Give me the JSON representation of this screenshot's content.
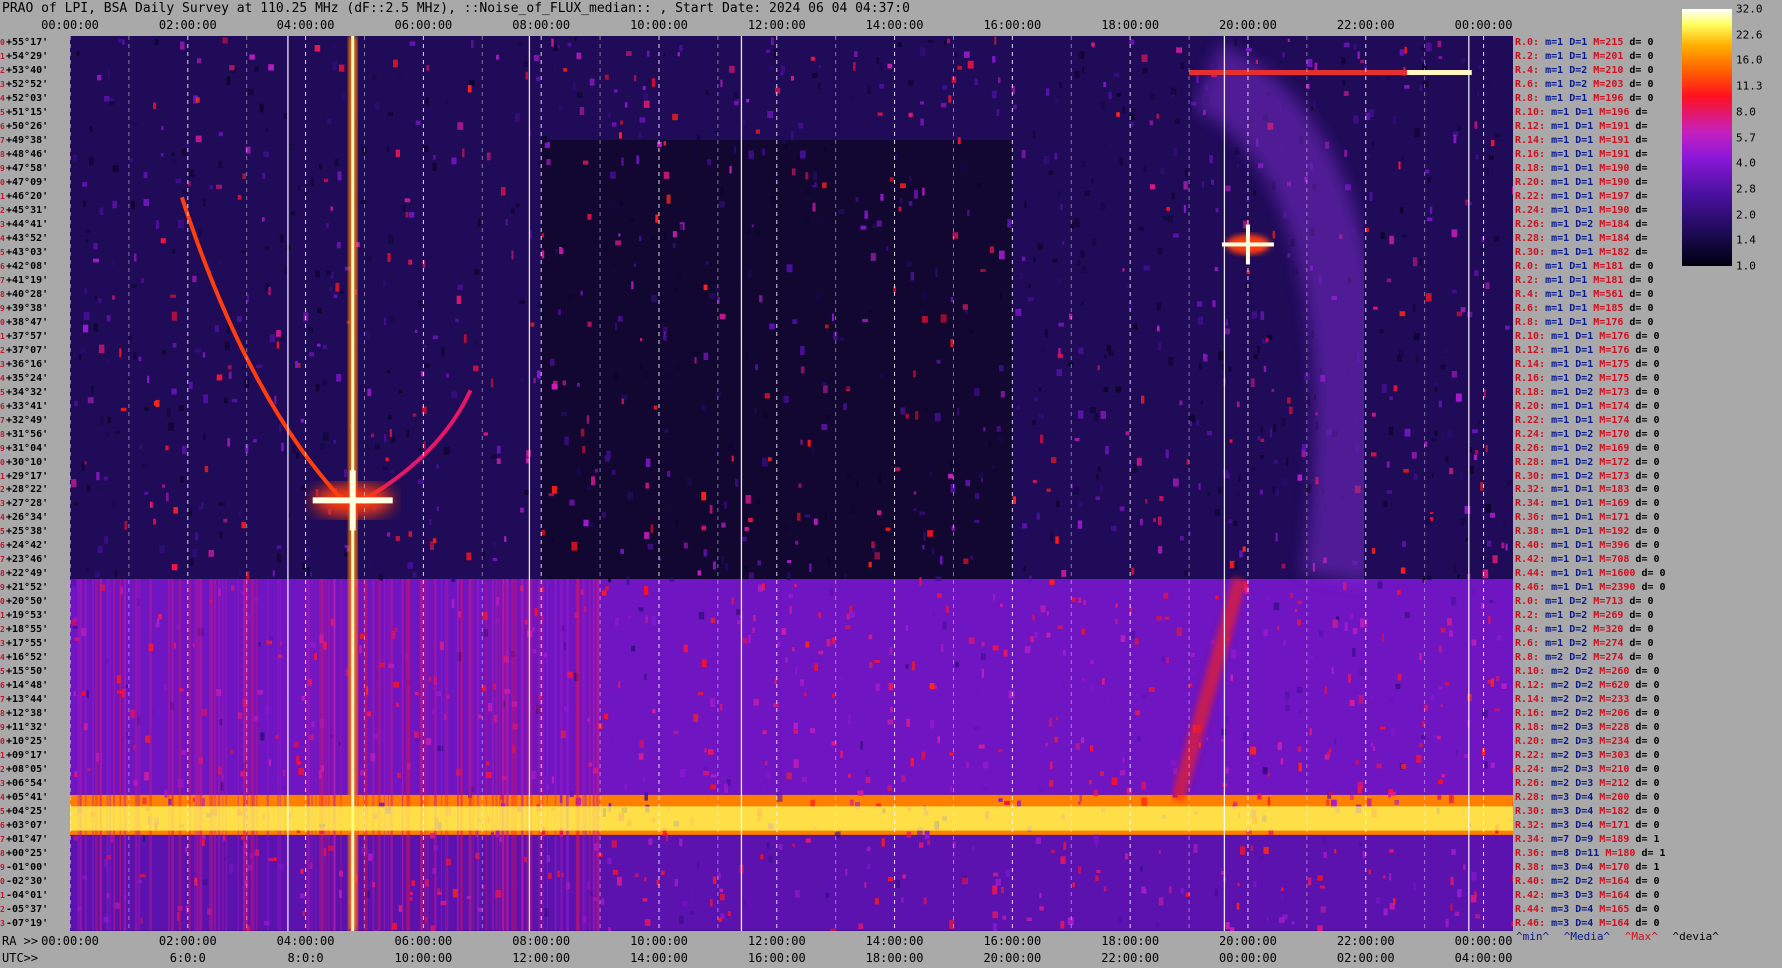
{
  "title": "PRAO of LPI, BSA Daily Survey at 110.25 MHz (dF::2.5 MHz), ::Noise_of_FLUX_median:: , Start Date: 2024 06 04 04:37:0",
  "top_ticks": [
    "00:00:00",
    "02:00:00",
    "04:00:00",
    "06:00:00",
    "08:00:00",
    "10:00:00",
    "12:00:00",
    "14:00:00",
    "16:00:00",
    "18:00:00",
    "20:00:00",
    "22:00:00",
    "00:00:00"
  ],
  "ra_lead": "RA >>",
  "ra_ticks": [
    "00:00:00",
    "02:00:00",
    "04:00:00",
    "06:00:00",
    "08:00:00",
    "10:00:00",
    "12:00:00",
    "14:00:00",
    "16:00:00",
    "18:00:00",
    "20:00:00",
    "22:00:00",
    "00:00:00"
  ],
  "utc_lead": "UTC>>",
  "utc_ticks": [
    "6:0:0",
    "8:0:0",
    "10:00:00",
    "12:00:00",
    "14:00:00",
    "16:00:00",
    "18:00:00",
    "20:00:00",
    "22:00:00",
    "00:00:00",
    "02:00:00",
    "04:00:00"
  ],
  "declinations": [
    "+55°17'",
    "+54°29'",
    "+53°40'",
    "+52°52'",
    "+52°03'",
    "+51°15'",
    "+50°26'",
    "+49°38'",
    "+48°46'",
    "+47°58'",
    "+47°09'",
    "+46°20'",
    "+45°31'",
    "+44°41'",
    "+43°52'",
    "+43°03'",
    "+42°08'",
    "+41°19'",
    "+40°28'",
    "+39°38'",
    "+38°47'",
    "+37°57'",
    "+37°07'",
    "+36°16'",
    "+35°24'",
    "+34°32'",
    "+33°41'",
    "+32°49'",
    "+31°56'",
    "+31°04'",
    "+30°10'",
    "+29°17'",
    "+28°22'",
    "+27°28'",
    "+26°34'",
    "+25°38'",
    "+24°42'",
    "+23°46'",
    "+22°49'",
    "+21°52'",
    "+20°50'",
    "+19°53'",
    "+18°55'",
    "+17°55'",
    "+16°52'",
    "+15°50'",
    "+14°48'",
    "+13°44'",
    "+12°38'",
    "+11°32'",
    "+10°25'",
    "+09°17'",
    "+08°05'",
    "+06°54'",
    "+05°41'",
    "+04°25'",
    "+03°07'",
    "+01°47'",
    "+00°25'",
    "-01°00'",
    "-02°30'",
    "-04°01'",
    "-05°37'",
    "-07°19'"
  ],
  "stats": [
    [
      "R.0:",
      "m=1 D=1",
      "M=215",
      "d= 0"
    ],
    [
      "R.2:",
      "m=1 D=1",
      "M=201",
      "d= 0"
    ],
    [
      "R.4:",
      "m=1 D=2",
      "M=210",
      "d= 0"
    ],
    [
      "R.6:",
      "m=1 D=2",
      "M=203",
      "d= 0"
    ],
    [
      "R.8:",
      "m=1 D=1",
      "M=196",
      "d= 0"
    ],
    [
      "R.10:",
      "m=1 D=1",
      "M=196",
      "d="
    ],
    [
      "R.12:",
      "m=1 D=1",
      "M=191",
      "d="
    ],
    [
      "R.14:",
      "m=1 D=1",
      "M=191",
      "d="
    ],
    [
      "R.16:",
      "m=1 D=1",
      "M=191",
      "d="
    ],
    [
      "R.18:",
      "m=1 D=1",
      "M=190",
      "d="
    ],
    [
      "R.20:",
      "m=1 D=1",
      "M=190",
      "d="
    ],
    [
      "R.22:",
      "m=1 D=1",
      "M=197",
      "d="
    ],
    [
      "R.24:",
      "m=1 D=1",
      "M=190",
      "d="
    ],
    [
      "R.26:",
      "m=1 D=2",
      "M=184",
      "d="
    ],
    [
      "R.28:",
      "m=1 D=1",
      "M=184",
      "d="
    ],
    [
      "R.30:",
      "m=1 D=1",
      "M=182",
      "d="
    ],
    [
      "R.0:",
      "m=1 D=1",
      "M=181",
      "d= 0"
    ],
    [
      "R.2:",
      "m=1 D=1",
      "M=181",
      "d= 0"
    ],
    [
      "R.4:",
      "m=1 D=1",
      "M=561",
      "d= 0"
    ],
    [
      "R.6:",
      "m=1 D=1",
      "M=185",
      "d= 0"
    ],
    [
      "R.8:",
      "m=1 D=1",
      "M=176",
      "d= 0"
    ],
    [
      "R.10:",
      "m=1 D=1",
      "M=176",
      "d= 0"
    ],
    [
      "R.12:",
      "m=1 D=1",
      "M=176",
      "d= 0"
    ],
    [
      "R.14:",
      "m=1 D=1",
      "M=175",
      "d= 0"
    ],
    [
      "R.16:",
      "m=1 D=2",
      "M=175",
      "d= 0"
    ],
    [
      "R.18:",
      "m=1 D=2",
      "M=173",
      "d= 0"
    ],
    [
      "R.20:",
      "m=1 D=1",
      "M=174",
      "d= 0"
    ],
    [
      "R.22:",
      "m=1 D=1",
      "M=174",
      "d= 0"
    ],
    [
      "R.24:",
      "m=1 D=2",
      "M=170",
      "d= 0"
    ],
    [
      "R.26:",
      "m=1 D=2",
      "M=169",
      "d= 0"
    ],
    [
      "R.28:",
      "m=1 D=2",
      "M=172",
      "d= 0"
    ],
    [
      "R.30:",
      "m=1 D=2",
      "M=173",
      "d= 0"
    ],
    [
      "R.32:",
      "m=1 D=1",
      "M=183",
      "d= 0"
    ],
    [
      "R.34:",
      "m=1 D=1",
      "M=169",
      "d= 0"
    ],
    [
      "R.36:",
      "m=1 D=1",
      "M=171",
      "d= 0"
    ],
    [
      "R.38:",
      "m=1 D=1",
      "M=192",
      "d= 0"
    ],
    [
      "R.40:",
      "m=1 D=1",
      "M=396",
      "d= 0"
    ],
    [
      "R.42:",
      "m=1 D=1",
      "M=708",
      "d= 0"
    ],
    [
      "R.44:",
      "m=1 D=1",
      "M=1600",
      "d= 0"
    ],
    [
      "R.46:",
      "m=1 D=1",
      "M=2390",
      "d= 0"
    ],
    [
      "R.0:",
      "m=1 D=2",
      "M=713",
      "d= 0"
    ],
    [
      "R.2:",
      "m=1 D=2",
      "M=269",
      "d= 0"
    ],
    [
      "R.4:",
      "m=1 D=2",
      "M=320",
      "d= 0"
    ],
    [
      "R.6:",
      "m=1 D=2",
      "M=274",
      "d= 0"
    ],
    [
      "R.8:",
      "m=2 D=2",
      "M=274",
      "d= 0"
    ],
    [
      "R.10:",
      "m=2 D=2",
      "M=260",
      "d= 0"
    ],
    [
      "R.12:",
      "m=2 D=2",
      "M=620",
      "d= 0"
    ],
    [
      "R.14:",
      "m=2 D=2",
      "M=233",
      "d= 0"
    ],
    [
      "R.16:",
      "m=2 D=2",
      "M=206",
      "d= 0"
    ],
    [
      "R.18:",
      "m=2 D=3",
      "M=228",
      "d= 0"
    ],
    [
      "R.20:",
      "m=2 D=3",
      "M=234",
      "d= 0"
    ],
    [
      "R.22:",
      "m=2 D=3",
      "M=303",
      "d= 0"
    ],
    [
      "R.24:",
      "m=2 D=3",
      "M=210",
      "d= 0"
    ],
    [
      "R.26:",
      "m=2 D=3",
      "M=212",
      "d= 0"
    ],
    [
      "R.28:",
      "m=3 D=4",
      "M=200",
      "d= 0"
    ],
    [
      "R.30:",
      "m=3 D=4",
      "M=182",
      "d= 0"
    ],
    [
      "R.32:",
      "m=3 D=4",
      "M=171",
      "d= 0"
    ],
    [
      "R.34:",
      "m=7 D=9",
      "M=189",
      "d= 1"
    ],
    [
      "R.36:",
      "m=8 D=11",
      "M=180",
      "d= 1"
    ],
    [
      "R.38:",
      "m=3 D=4",
      "M=170",
      "d= 1"
    ],
    [
      "R.40:",
      "m=2 D=2",
      "M=164",
      "d= 0"
    ],
    [
      "R.42:",
      "m=3 D=3",
      "M=164",
      "d= 0"
    ],
    [
      "R.44:",
      "m=3 D=4",
      "M=165",
      "d= 0"
    ],
    [
      "R.46:",
      "m=3 D=4",
      "M=164",
      "d= 0"
    ]
  ],
  "colorbar": {
    "labels": [
      "32.0",
      "22.6",
      "16.0",
      "11.3",
      "8.0",
      "5.7",
      "4.0",
      "2.8",
      "2.0",
      "1.4",
      "1.0"
    ]
  },
  "legend": {
    "min": "^min^",
    "median": "^Media^",
    "max": "^Max^",
    "dev": "^devia^",
    "colors": {
      "min": "#0a1a8a",
      "median": "#0a1a8a",
      "max": "#d01020",
      "dev": "#000000"
    }
  },
  "chart_data": {
    "type": "heatmap",
    "title": "PRAO of LPI, BSA Daily Survey at 110.25 MHz (dF::2.5 MHz), ::Noise_of_FLUX_median:: , Start Date: 2024 06 04 04:37:0",
    "x_axis_top": "RA 00:00:00 – 24:00:00",
    "xlim_hours": [
      0,
      24.5
    ],
    "ylim_deg": [
      55.28,
      -7.32
    ],
    "colorscale_range": [
      1.0,
      32.0
    ],
    "colorscale_labels": [
      32.0,
      22.6,
      16.0,
      11.3,
      8.0,
      5.7,
      4.0,
      2.8,
      2.0,
      1.4,
      1.0
    ],
    "zones": [
      {
        "dec_from": 55.3,
        "dec_to": 17.3,
        "level": 1.6
      },
      {
        "dec_from": 17.3,
        "dec_to": 2.2,
        "level": 3.5
      },
      {
        "dec_from": 2.2,
        "dec_to": -0.6,
        "level": 16.0
      },
      {
        "dec_from": -0.6,
        "dec_to": -7.3,
        "level": 3.0
      }
    ],
    "sources": [
      {
        "ra_h": 4.8,
        "dec": 22.8,
        "level": 32.0
      },
      {
        "ra_h": 20.0,
        "dec": 40.7,
        "level": 32.0
      }
    ]
  }
}
